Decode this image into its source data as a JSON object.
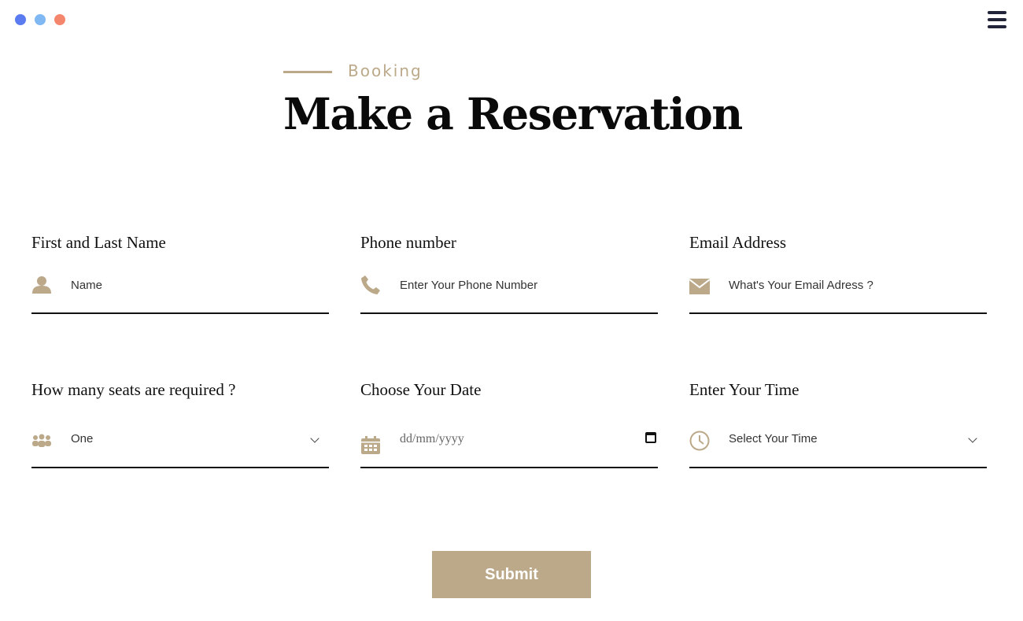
{
  "window": {
    "dot_colors": [
      "#5b7cf0",
      "#7fb8f2",
      "#f5866e"
    ]
  },
  "header": {
    "menu_icon": "hamburger-menu-icon"
  },
  "hero": {
    "eyebrow": "Booking",
    "title": "Make a Reservation"
  },
  "form": {
    "name": {
      "label": "First and Last Name",
      "placeholder": "Name",
      "icon": "user-icon"
    },
    "phone": {
      "label": "Phone number",
      "placeholder": "Enter Your Phone Number",
      "icon": "phone-icon"
    },
    "email": {
      "label": "Email Address",
      "placeholder": "What's Your Email Adress ?",
      "icon": "envelope-icon"
    },
    "seats": {
      "label": "How many seats are required ?",
      "value": "One",
      "icon": "people-icon"
    },
    "date": {
      "label": "Choose Your Date",
      "placeholder": "dd/mm/yyyy",
      "icon": "calendar-icon"
    },
    "time": {
      "label": "Enter Your Time",
      "value": "Select Your Time",
      "icon": "clock-icon"
    },
    "submit_label": "Submit"
  },
  "colors": {
    "accent": "#bba98a",
    "text": "#111111",
    "menu": "#22243a"
  }
}
